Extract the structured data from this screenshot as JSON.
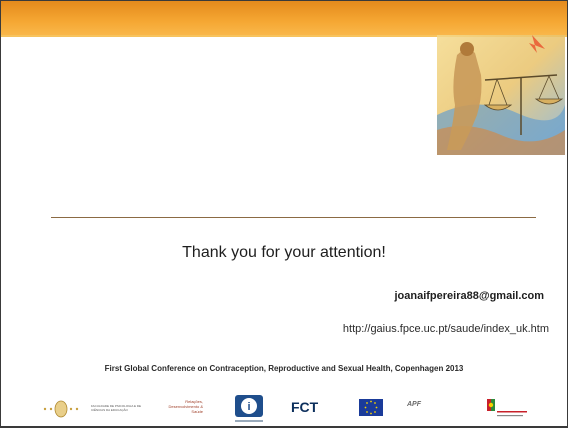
{
  "slide": {
    "thanks": "Thank you for your attention!",
    "email": "joanaifpereira88@gmail.com",
    "url": "http://gaius.fpce.uc.pt/saude/index_uk.htm",
    "conference": "First Global Conference on Contraception, Reproductive and Sexual Health, Copenhagen 2013"
  },
  "logos": {
    "fpce": "FACULDADE DE PSICOLOGIA E DE CIÊNCIAS DA EDUCAÇÃO",
    "relacoes": "Relações, Desenvolvimento & Saúde",
    "fct": "FCT",
    "apf": "APF"
  },
  "colors": {
    "top_band": "#f5a733",
    "divider": "#8b6a43"
  },
  "icons": [
    "justice-scales-illustration",
    "university-seal-icon",
    "info-icon",
    "eu-flag-icon",
    "ministry-emblem-icon"
  ]
}
